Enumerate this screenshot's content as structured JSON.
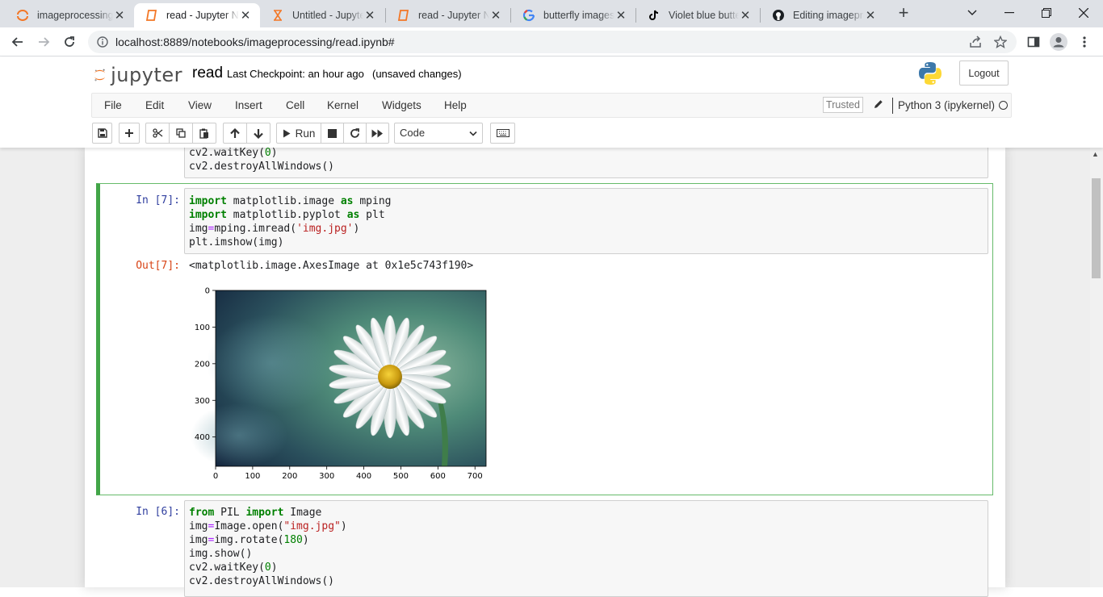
{
  "browser": {
    "tabs": [
      {
        "title": "imageprocessing",
        "icon": "jupyter-icon",
        "active": false
      },
      {
        "title": "read - Jupyter Notebook",
        "icon": "notebook-icon",
        "active": true
      },
      {
        "title": "Untitled - Jupyter Notebook",
        "icon": "hourglass-icon",
        "active": false
      },
      {
        "title": "read - Jupyter Notebook",
        "icon": "notebook-icon",
        "active": false
      },
      {
        "title": "butterfly images",
        "icon": "google-icon",
        "active": false
      },
      {
        "title": "Violet blue butterfly",
        "icon": "tiktok-icon",
        "active": false
      },
      {
        "title": "Editing imageprocessing",
        "icon": "github-icon",
        "active": false
      }
    ],
    "url": "localhost:8889/notebooks/imageprocessing/read.ipynb#"
  },
  "header": {
    "logo_text": "jupyter",
    "notebook_name": "read",
    "checkpoint": "Last Checkpoint: an hour ago",
    "autosave": "(unsaved changes)",
    "logout": "Logout"
  },
  "menubar": {
    "items": [
      "File",
      "Edit",
      "View",
      "Insert",
      "Cell",
      "Kernel",
      "Widgets",
      "Help"
    ],
    "trusted": "Trusted",
    "kernel": "Python 3 (ipykernel)"
  },
  "toolbar": {
    "run_label": "Run",
    "cell_type": "Code"
  },
  "cells": {
    "prev_tail": [
      "cv2.waitKey(0)",
      "cv2.destroyAllWindows()"
    ],
    "cell7": {
      "prompt_in": "In [7]:",
      "prompt_out": "Out[7]:",
      "output_text": "<matplotlib.image.AxesImage at 0x1e5c743f190>"
    },
    "cell6": {
      "prompt_in": "In [6]:"
    }
  },
  "chart_data": {
    "type": "image",
    "x_ticks": [
      "0",
      "100",
      "200",
      "300",
      "400",
      "500",
      "600",
      "700"
    ],
    "y_ticks": [
      "0",
      "100",
      "200",
      "300",
      "400"
    ],
    "xlim": [
      0,
      730
    ],
    "ylim": [
      480,
      0
    ],
    "grid": false
  }
}
